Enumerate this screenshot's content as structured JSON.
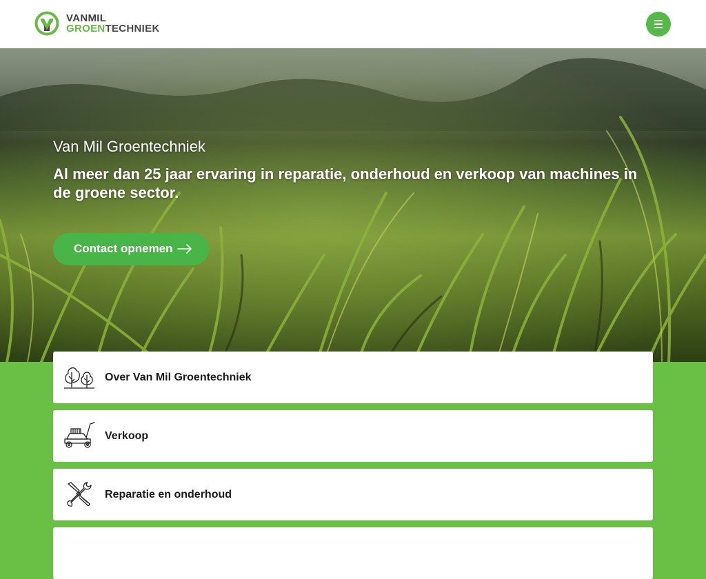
{
  "header": {
    "logo_top": "VANMIL",
    "logo_bottom_green_1": "GR",
    "logo_bottom_o": "O",
    "logo_bottom_green_2": "EN",
    "logo_bottom_gray": "TECHNIEK",
    "menu_icon": "hamburger-icon",
    "brand_color": "#6abf45"
  },
  "hero": {
    "title": "Van Mil Groentechniek",
    "subtitle": "Al meer dan 25 jaar ervaring in reparatie, onderhoud en verkoop van machines in de groene sector.",
    "cta_label": "Contact opnemen",
    "cta_icon": "arrow-right-icon",
    "cta_color": "#49b548"
  },
  "cards": [
    {
      "label": "Over Van Mil Groentechniek",
      "icon": "trees-icon"
    },
    {
      "label": "Verkoop",
      "icon": "lawnmower-icon"
    },
    {
      "label": "Reparatie en onderhoud",
      "icon": "tools-icon"
    }
  ]
}
